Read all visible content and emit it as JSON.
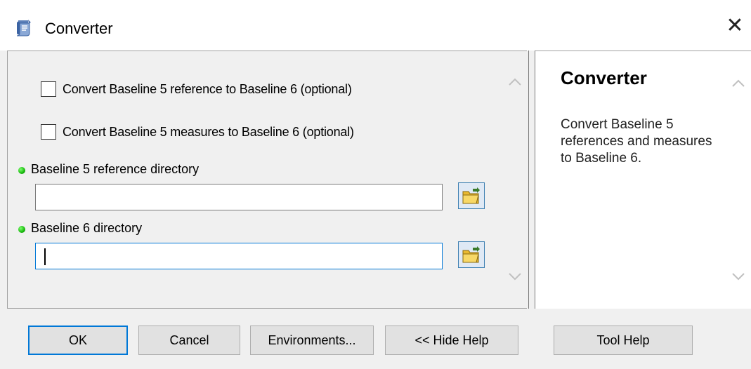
{
  "window": {
    "title": "Converter",
    "close_glyph": "✕",
    "icon": "toolbox-script-icon"
  },
  "form": {
    "checkbox_ref": {
      "label": "Convert Baseline 5 reference to Baseline 6 (optional)",
      "checked": false
    },
    "checkbox_measures": {
      "label": "Convert Baseline 5 measures to Baseline 6 (optional)",
      "checked": false
    },
    "ref_dir": {
      "label": "Baseline 5 reference directory",
      "value": "",
      "required": true
    },
    "out_dir": {
      "label": "Baseline 6 directory",
      "value": "",
      "required": true,
      "focused": true
    }
  },
  "help": {
    "title": "Converter",
    "body": "Convert Baseline 5 references and measures to Baseline 6."
  },
  "buttons": {
    "ok": "OK",
    "cancel": "Cancel",
    "environments": "Environments...",
    "hide_help": "<< Hide Help",
    "tool_help": "Tool Help"
  },
  "colors": {
    "accent": "#0078d7",
    "required_dot": "#17b80c",
    "background": "#f0f0f0"
  }
}
